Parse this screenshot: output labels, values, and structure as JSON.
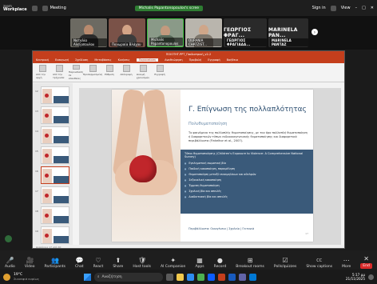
{
  "zoom": {
    "brand_top": "zoom",
    "brand_bottom": "Workplace",
    "meeting_label": "Meeting",
    "shared_screen_label": "Michalis Papantonopoulos's scree",
    "sign_in": "Sign in",
    "view": "View"
  },
  "participants": [
    {
      "name": "Ναταλία Αλεξοπουλου",
      "type": "video"
    },
    {
      "name": "Πανωραία Βλάχου",
      "type": "video"
    },
    {
      "name": "Michalis Papantonopoulos",
      "type": "video"
    },
    {
      "name": "OURANIA CHATZIST...",
      "type": "video"
    },
    {
      "name": "ΓΕΩΡΓΙΟΣ ΦΡΑΓΙΑΔΑ...",
      "display": "ΓΕΩΡΓΙΟΣ ΦΡΑΓ...",
      "type": "text"
    },
    {
      "name": "MARINELA PANTAZ",
      "display": "MARINELA PAN...",
      "type": "text"
    }
  ],
  "ppt": {
    "window_title": "ΠΟΙΟΤΗΤ.PPT_Παιδιατρική_v2-2",
    "tabs": [
      "Κεντρική",
      "Εισαγωγή",
      "Σχεδίαση",
      "Μεταβάσεις",
      "Κινήσεις",
      "Παρουσίαση",
      "Αναθεώρηση",
      "Προβολή",
      "Εγγραφή",
      "Βοήθεια"
    ],
    "active_tab": "Παρουσίαση",
    "ribbon_groups": [
      "Από την αρχή",
      "Από την τρέχουσα",
      "Παρουσίαση σε απευθείας",
      "Προσαρμοσμένη",
      "Ρύθμιση",
      "Απόκρυψη",
      "Δοκιμή χρονισμών",
      "Εγγραφή"
    ],
    "slide_numbers": [
      "12",
      "13",
      "14",
      "15",
      "16",
      "17",
      "18",
      "19"
    ],
    "status_text": "Διαφάνεια 17 από 40"
  },
  "slide": {
    "title": "Γ. Επίγνωση της πολλαπλότητας",
    "subtitle": "Πολυθυματοποίηση",
    "body": "Το φαινόμενο της πολλαπλής θυματοποίησης, με τον όρο πολλαπλή θυματοποίηση ή διαφορετικών τύπων ενδοοικογενειακής θυματοποίησης και διαφορετικά περιβάλλοντα (Finkelhor et al., 2007).",
    "panel_heading": "Τύποι θυματοποίησης (Children's Exposure to Violence: A Comprehensive National Survey)",
    "panel_items": [
      "Εγκληματική σωματική βία",
      "Παιδική κακοποίηση, παραμέληση",
      "Θυματοποίηση μεταξύ συνομηλίκων και αδελφών",
      "Σεξουαλική κακοποίηση",
      "Έμμεση θυματοποίηση",
      "Σχολική βία και απειλές",
      "Διαδικτυακή βία και απειλές"
    ],
    "footer": "Περιβάλλοντα: Οικογένεια | Σχολείο | Γειτονιά",
    "page_number": "17"
  },
  "controls": [
    {
      "label": "Audio",
      "icon": "🎤"
    },
    {
      "label": "Video",
      "icon": "🎥"
    },
    {
      "label": "Participants",
      "icon": "👥"
    },
    {
      "label": "Chat",
      "icon": "💬"
    },
    {
      "label": "React",
      "icon": "♡"
    },
    {
      "label": "Share",
      "icon": "⬆"
    },
    {
      "label": "Host tools",
      "icon": "🛡"
    },
    {
      "label": "AI Companion",
      "icon": "✦"
    },
    {
      "label": "Apps",
      "icon": "▦"
    },
    {
      "label": "Record",
      "icon": "●"
    },
    {
      "label": "Breakout rooms",
      "icon": "⊞"
    },
    {
      "label": "Polls/quizzes",
      "icon": "☑"
    },
    {
      "label": "Show captions",
      "icon": "CC"
    },
    {
      "label": "More",
      "icon": "⋯"
    },
    {
      "label": "End",
      "icon": "✕",
      "end": true
    }
  ],
  "taskbar": {
    "weather_temp": "19°C",
    "weather_desc": "Συννεφιά κυρίως",
    "search_placeholder": "Αναζήτηση",
    "time": "5:17 μμ",
    "date": "21/11/2025"
  }
}
